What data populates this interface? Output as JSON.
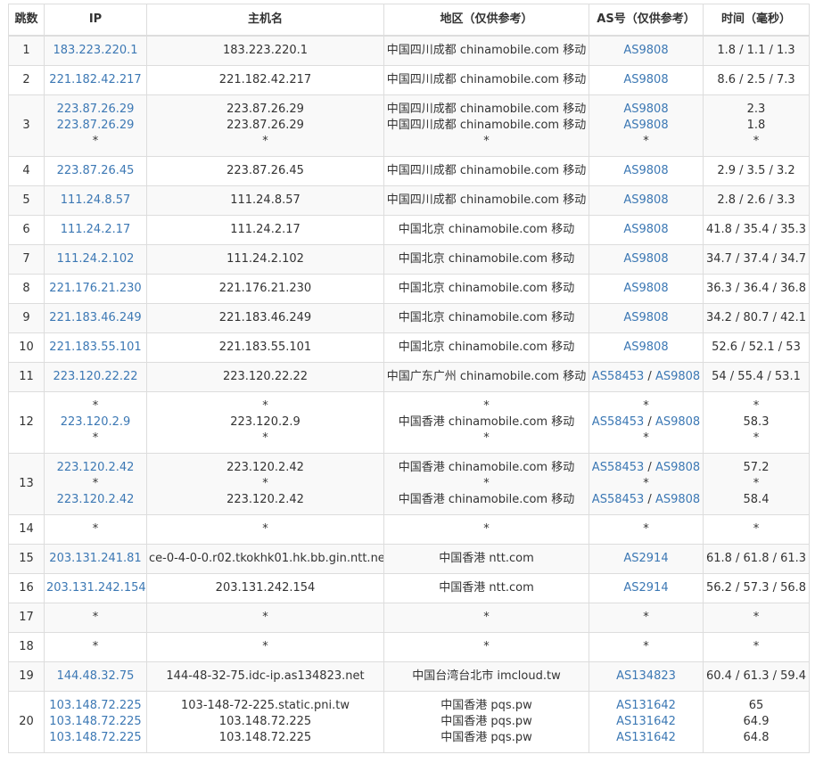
{
  "colors": {
    "link": "#3c78b4",
    "text": "#333333",
    "border": "#dddddd",
    "stripe": "#f9f9f9"
  },
  "headers": [
    "跳数",
    "IP",
    "主机名",
    "地区（仅供参考）",
    "AS号（仅供参考）",
    "时间（毫秒）"
  ],
  "hops": [
    {
      "hop": "1",
      "lines": [
        {
          "ip": "183.223.220.1",
          "host": "183.223.220.1",
          "region": "中国四川成都 chinamobile.com 移动",
          "as": [
            "AS9808"
          ],
          "time": "1.8 / 1.1 / 1.3"
        }
      ]
    },
    {
      "hop": "2",
      "lines": [
        {
          "ip": "221.182.42.217",
          "host": "221.182.42.217",
          "region": "中国四川成都 chinamobile.com 移动",
          "as": [
            "AS9808"
          ],
          "time": "8.6 / 2.5 / 7.3"
        }
      ]
    },
    {
      "hop": "3",
      "lines": [
        {
          "ip": "223.87.26.29",
          "host": "223.87.26.29",
          "region": "中国四川成都 chinamobile.com 移动",
          "as": [
            "AS9808"
          ],
          "time": "2.3"
        },
        {
          "ip": "223.87.26.29",
          "host": "223.87.26.29",
          "region": "中国四川成都 chinamobile.com 移动",
          "as": [
            "AS9808"
          ],
          "time": "1.8"
        },
        {
          "ip": "*",
          "host": "*",
          "region": "*",
          "as": [
            "*"
          ],
          "time": "*"
        }
      ]
    },
    {
      "hop": "4",
      "lines": [
        {
          "ip": "223.87.26.45",
          "host": "223.87.26.45",
          "region": "中国四川成都 chinamobile.com 移动",
          "as": [
            "AS9808"
          ],
          "time": "2.9 / 3.5 / 3.2"
        }
      ]
    },
    {
      "hop": "5",
      "lines": [
        {
          "ip": "111.24.8.57",
          "host": "111.24.8.57",
          "region": "中国四川成都 chinamobile.com 移动",
          "as": [
            "AS9808"
          ],
          "time": "2.8 / 2.6 / 3.3"
        }
      ]
    },
    {
      "hop": "6",
      "lines": [
        {
          "ip": "111.24.2.17",
          "host": "111.24.2.17",
          "region": "中国北京 chinamobile.com 移动",
          "as": [
            "AS9808"
          ],
          "time": "41.8 / 35.4 / 35.3"
        }
      ]
    },
    {
      "hop": "7",
      "lines": [
        {
          "ip": "111.24.2.102",
          "host": "111.24.2.102",
          "region": "中国北京 chinamobile.com 移动",
          "as": [
            "AS9808"
          ],
          "time": "34.7 / 37.4 / 34.7"
        }
      ]
    },
    {
      "hop": "8",
      "lines": [
        {
          "ip": "221.176.21.230",
          "host": "221.176.21.230",
          "region": "中国北京 chinamobile.com 移动",
          "as": [
            "AS9808"
          ],
          "time": "36.3 / 36.4 / 36.8"
        }
      ]
    },
    {
      "hop": "9",
      "lines": [
        {
          "ip": "221.183.46.249",
          "host": "221.183.46.249",
          "region": "中国北京 chinamobile.com 移动",
          "as": [
            "AS9808"
          ],
          "time": "34.2 / 80.7 / 42.1"
        }
      ]
    },
    {
      "hop": "10",
      "lines": [
        {
          "ip": "221.183.55.101",
          "host": "221.183.55.101",
          "region": "中国北京 chinamobile.com 移动",
          "as": [
            "AS9808"
          ],
          "time": "52.6 / 52.1 / 53"
        }
      ]
    },
    {
      "hop": "11",
      "lines": [
        {
          "ip": "223.120.22.22",
          "host": "223.120.22.22",
          "region": "中国广东广州 chinamobile.com 移动",
          "as": [
            "AS58453",
            "AS9808"
          ],
          "time": "54 / 55.4 / 53.1"
        }
      ]
    },
    {
      "hop": "12",
      "lines": [
        {
          "ip": "*",
          "host": "*",
          "region": "*",
          "as": [
            "*"
          ],
          "time": "*"
        },
        {
          "ip": "223.120.2.9",
          "host": "223.120.2.9",
          "region": "中国香港 chinamobile.com 移动",
          "as": [
            "AS58453",
            "AS9808"
          ],
          "time": "58.3"
        },
        {
          "ip": "*",
          "host": "*",
          "region": "*",
          "as": [
            "*"
          ],
          "time": "*"
        }
      ]
    },
    {
      "hop": "13",
      "lines": [
        {
          "ip": "223.120.2.42",
          "host": "223.120.2.42",
          "region": "中国香港 chinamobile.com 移动",
          "as": [
            "AS58453",
            "AS9808"
          ],
          "time": "57.2"
        },
        {
          "ip": "*",
          "host": "*",
          "region": "*",
          "as": [
            "*"
          ],
          "time": "*"
        },
        {
          "ip": "223.120.2.42",
          "host": "223.120.2.42",
          "region": "中国香港 chinamobile.com 移动",
          "as": [
            "AS58453",
            "AS9808"
          ],
          "time": "58.4"
        }
      ]
    },
    {
      "hop": "14",
      "lines": [
        {
          "ip": "*",
          "host": "*",
          "region": "*",
          "as": [
            "*"
          ],
          "time": "*"
        }
      ]
    },
    {
      "hop": "15",
      "lines": [
        {
          "ip": "203.131.241.81",
          "host": "ce-0-4-0-0.r02.tkokhk01.hk.bb.gin.ntt.net",
          "region": "中国香港 ntt.com",
          "as": [
            "AS2914"
          ],
          "time": "61.8 / 61.8 / 61.3"
        }
      ]
    },
    {
      "hop": "16",
      "lines": [
        {
          "ip": "203.131.242.154",
          "host": "203.131.242.154",
          "region": "中国香港 ntt.com",
          "as": [
            "AS2914"
          ],
          "time": "56.2 / 57.3 / 56.8"
        }
      ]
    },
    {
      "hop": "17",
      "lines": [
        {
          "ip": "*",
          "host": "*",
          "region": "*",
          "as": [
            "*"
          ],
          "time": "*"
        }
      ]
    },
    {
      "hop": "18",
      "lines": [
        {
          "ip": "*",
          "host": "*",
          "region": "*",
          "as": [
            "*"
          ],
          "time": "*"
        }
      ]
    },
    {
      "hop": "19",
      "lines": [
        {
          "ip": "144.48.32.75",
          "host": "144-48-32-75.idc-ip.as134823.net",
          "region": "中国台湾台北市 imcloud.tw",
          "as": [
            "AS134823"
          ],
          "time": "60.4 / 61.3 / 59.4"
        }
      ]
    },
    {
      "hop": "20",
      "lines": [
        {
          "ip": "103.148.72.225",
          "host": "103-148-72-225.static.pni.tw",
          "region": "中国香港 pqs.pw",
          "as": [
            "AS131642"
          ],
          "time": "65"
        },
        {
          "ip": "103.148.72.225",
          "host": "103.148.72.225",
          "region": "中国香港 pqs.pw",
          "as": [
            "AS131642"
          ],
          "time": "64.9"
        },
        {
          "ip": "103.148.72.225",
          "host": "103.148.72.225",
          "region": "中国香港 pqs.pw",
          "as": [
            "AS131642"
          ],
          "time": "64.8"
        }
      ]
    }
  ]
}
